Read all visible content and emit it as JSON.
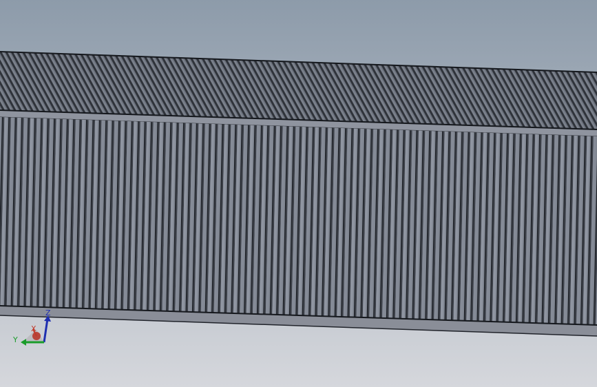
{
  "viewport": {
    "background_top": "#8e9cab",
    "background_bottom": "#d4d6db"
  },
  "model": {
    "name": "gear-rack",
    "edge_color": "#111418",
    "flank_light": "#8a909c",
    "flank_dark": "#3a3e46",
    "top_face": "#7c828d",
    "band_color": "#9599a3",
    "bottom_face": "#8c909a"
  },
  "triad": {
    "x_label": "X",
    "y_label": "Y",
    "z_label": "Z",
    "x_color": "#c0392b",
    "y_color": "#1a9c2a",
    "z_color": "#1f2fb0"
  }
}
